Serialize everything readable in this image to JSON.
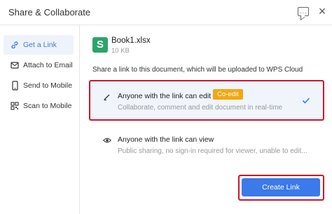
{
  "window": {
    "title": "Share & Collaborate"
  },
  "sidebar": {
    "items": [
      {
        "label": "Get a Link",
        "icon": "link-icon",
        "active": true
      },
      {
        "label": "Attach to Email",
        "icon": "mail-icon",
        "active": false
      },
      {
        "label": "Send to Mobile",
        "icon": "mobile-icon",
        "active": false
      },
      {
        "label": "Scan to Mobile",
        "icon": "qr-code-icon",
        "active": false
      }
    ]
  },
  "file": {
    "icon_letter": "S",
    "name": "Book1.xlsx",
    "size": "10 KB"
  },
  "share": {
    "description": "Share a link to this document, which will be uploaded to WPS Cloud",
    "options": [
      {
        "title": "Anyone with the link can edit",
        "badge": "Co-edit",
        "description": "Collaborate, comment and edit document in real-time",
        "selected": true,
        "icon": "pen-icon"
      },
      {
        "title": "Anyone with the link can view",
        "description": "Public sharing, no sign-in required for viewer, unable to edit...",
        "selected": false,
        "icon": "eye-icon"
      }
    ]
  },
  "actions": {
    "create_link_label": "Create Link"
  },
  "colors": {
    "accent": "#3b7ae8",
    "highlight": "#d0142c",
    "badge": "#f3a712",
    "file_icon": "#2ba56b"
  }
}
